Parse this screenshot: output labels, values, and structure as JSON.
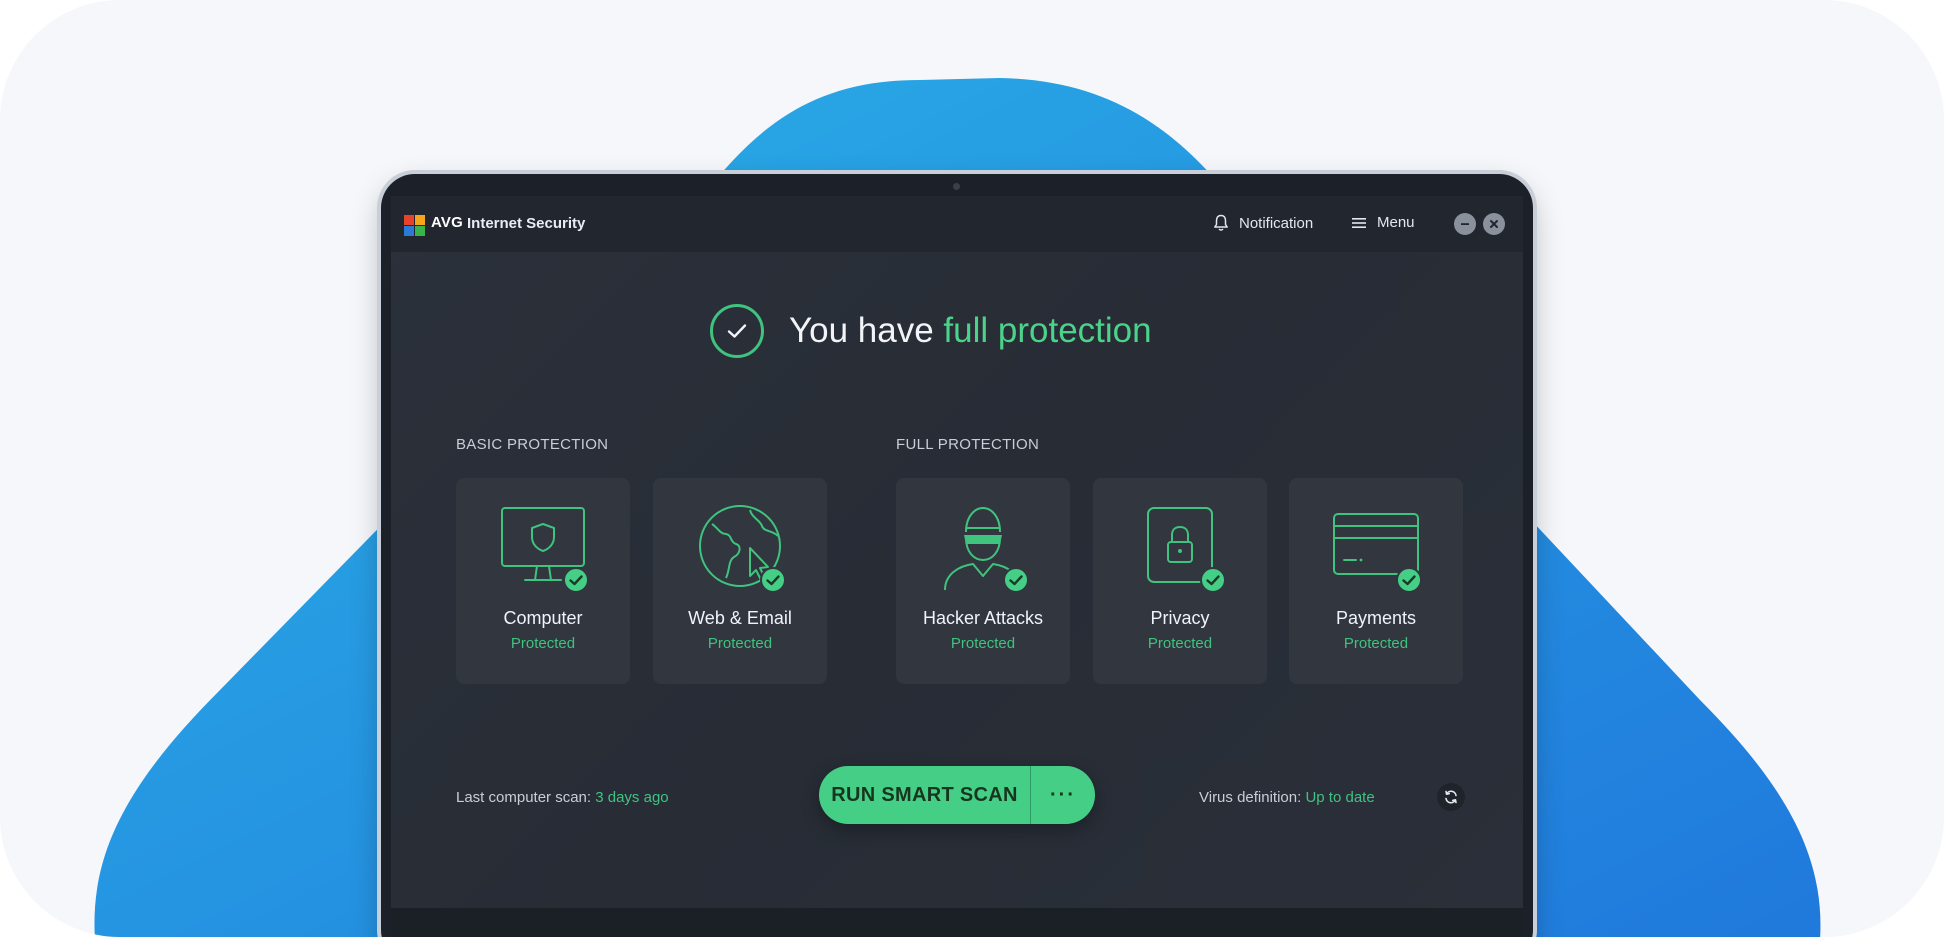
{
  "app": {
    "brand": "AVG",
    "product": "Internet Security",
    "notification_label": "Notification",
    "menu_label": "Menu"
  },
  "status": {
    "headline_prefix": "You have ",
    "headline_accent": "full protection"
  },
  "sections": {
    "basic_label": "BASIC PROTECTION",
    "full_label": "FULL PROTECTION"
  },
  "cards": [
    {
      "title": "Computer",
      "status": "Protected",
      "icon": "monitor-shield-icon"
    },
    {
      "title": "Web & Email",
      "status": "Protected",
      "icon": "globe-cursor-icon"
    },
    {
      "title": "Hacker Attacks",
      "status": "Protected",
      "icon": "hacker-icon"
    },
    {
      "title": "Privacy",
      "status": "Protected",
      "icon": "lock-icon"
    },
    {
      "title": "Payments",
      "status": "Protected",
      "icon": "credit-card-icon"
    }
  ],
  "footer": {
    "last_scan_label": "Last computer scan: ",
    "last_scan_value": "3 days ago",
    "scan_button": "RUN SMART SCAN",
    "more_button": "···",
    "virus_def_label": "Virus definition: ",
    "virus_def_value": "Up to date"
  },
  "colors": {
    "accent_green": "#45cf86",
    "status_green": "#3fc37e",
    "background_blue": "#29a6e2",
    "window_dark": "#2a2f38"
  }
}
